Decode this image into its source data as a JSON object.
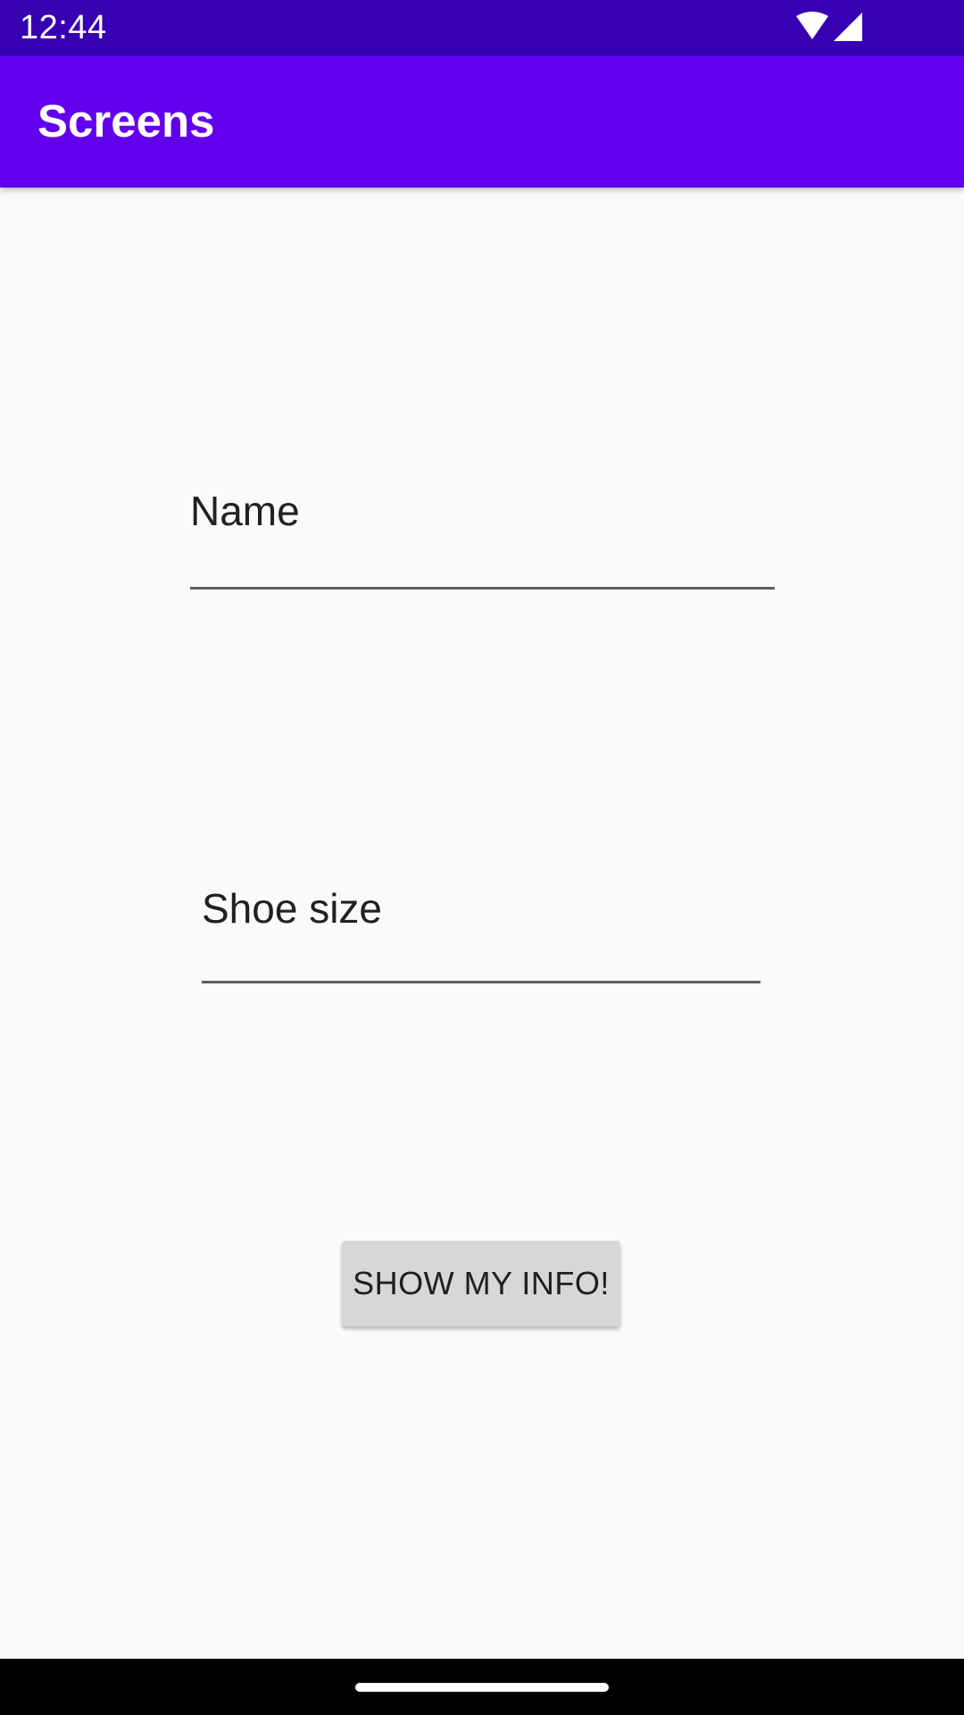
{
  "status_bar": {
    "time": "12:44",
    "icons": [
      "wifi-icon",
      "cellular-signal-icon"
    ],
    "background_color": "#3700b3"
  },
  "app_bar": {
    "title": "Screens",
    "background_color": "#6200ee"
  },
  "form": {
    "name_field": {
      "placeholder": "Name",
      "value": ""
    },
    "shoe_size_field": {
      "placeholder": "Shoe size",
      "value": ""
    },
    "show_button_label": "SHOW MY INFO!"
  },
  "nav_bar": {
    "icons": [
      "home-handle-icon"
    ]
  }
}
